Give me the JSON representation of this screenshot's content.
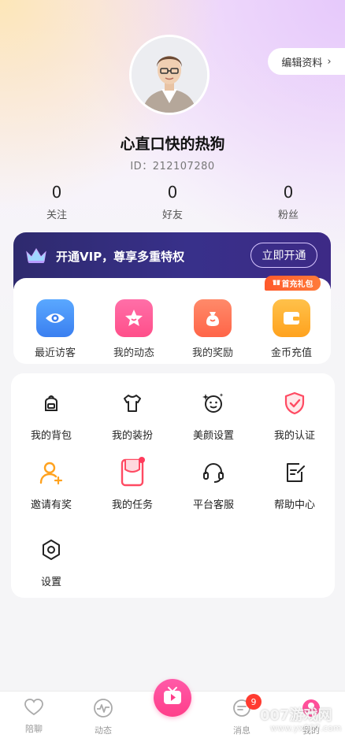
{
  "header": {
    "edit_label": "编辑资料",
    "edit_chevron": "›"
  },
  "profile": {
    "nickname": "心直口快的热狗",
    "uid_label": "ID：212107280"
  },
  "stats": [
    {
      "value": "0",
      "label": "关注"
    },
    {
      "value": "0",
      "label": "好友"
    },
    {
      "value": "0",
      "label": "粉丝"
    }
  ],
  "vip": {
    "text": "开通VIP，尊享多重特权",
    "button": "立即开通"
  },
  "quick": {
    "gift_badge": "首充礼包",
    "items": [
      {
        "label": "最近访客",
        "icon": "eye-icon"
      },
      {
        "label": "我的动态",
        "icon": "star-icon"
      },
      {
        "label": "我的奖励",
        "icon": "money-bag-icon"
      },
      {
        "label": "金币充值",
        "icon": "wallet-icon"
      }
    ]
  },
  "grid": [
    {
      "label": "我的背包",
      "icon": "backpack-icon"
    },
    {
      "label": "我的装扮",
      "icon": "tshirt-icon"
    },
    {
      "label": "美颜设置",
      "icon": "beauty-face-icon"
    },
    {
      "label": "我的认证",
      "icon": "shield-check-icon"
    },
    {
      "label": "邀请有奖",
      "icon": "invite-user-icon"
    },
    {
      "label": "我的任务",
      "icon": "task-icon"
    },
    {
      "label": "平台客服",
      "icon": "headset-icon"
    },
    {
      "label": "帮助中心",
      "icon": "help-edit-icon"
    },
    {
      "label": "设置",
      "icon": "gear-icon"
    }
  ],
  "tabbar": {
    "items": [
      {
        "label": "陪聊",
        "icon": "heart-icon"
      },
      {
        "label": "动态",
        "icon": "activity-icon"
      },
      {
        "label": "",
        "icon": "video-play-icon"
      },
      {
        "label": "消息",
        "icon": "message-icon"
      },
      {
        "label": "我的",
        "icon": "profile-icon"
      }
    ],
    "message_badge": "9"
  },
  "watermark": {
    "text": "007游戏网",
    "url": "www.yx007.com"
  },
  "colors": {
    "accent": "#ff3f8a",
    "vip_bg": "#2e2a6e",
    "badge": "#ff3b30"
  }
}
